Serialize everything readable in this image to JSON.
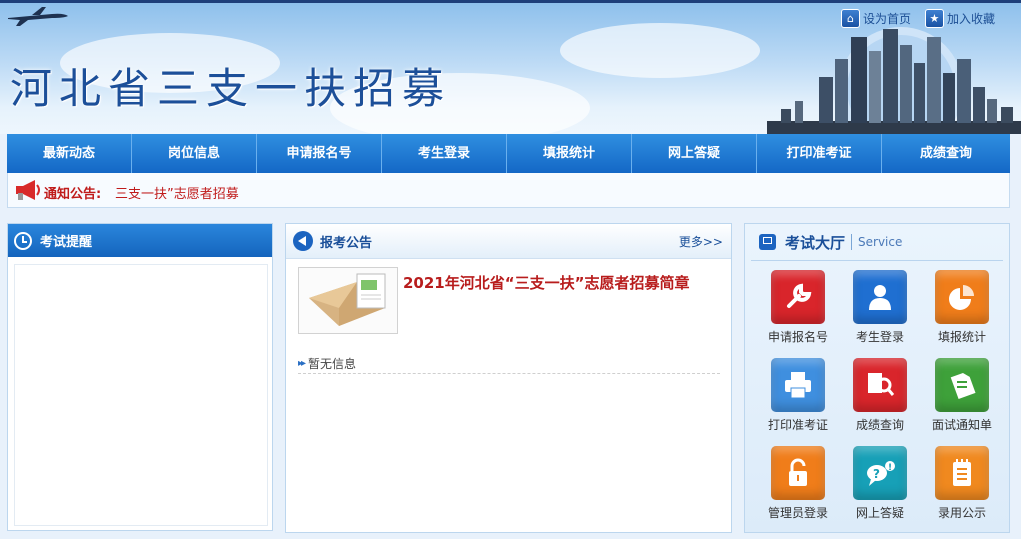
{
  "site": {
    "title": "河北省三支一扶招募"
  },
  "toplinks": [
    {
      "label": "设为首页",
      "icon": "home-icon"
    },
    {
      "label": "加入收藏",
      "icon": "star-icon"
    }
  ],
  "nav": [
    "最新动态",
    "岗位信息",
    "申请报名号",
    "考生登录",
    "填报统计",
    "网上答疑",
    "打印准考证",
    "成绩查询"
  ],
  "notice": {
    "label": "通知公告:",
    "text": "三支一扶”志愿者招募"
  },
  "left_panel": {
    "title": "考试提醒"
  },
  "mid_panel": {
    "title": "报考公告",
    "more": "更多>>",
    "headline": "2021年河北省“三支一扶”志愿者招募简章",
    "empty": "暂无信息"
  },
  "right_panel": {
    "title": "考试大厅",
    "subtitle": "Service",
    "tiles": [
      {
        "label": "申请报名号",
        "icon": "wrench-icon",
        "color": "#d9252b"
      },
      {
        "label": "考生登录",
        "icon": "user-icon",
        "color": "#1f6fd1"
      },
      {
        "label": "填报统计",
        "icon": "pie-chart-icon",
        "color": "#f07d1a"
      },
      {
        "label": "打印准考证",
        "icon": "printer-icon",
        "color": "#3f8fdf"
      },
      {
        "label": "成绩查询",
        "icon": "magnifier-icon",
        "color": "#d9252b"
      },
      {
        "label": "面试通知单",
        "icon": "document-icon",
        "color": "#3ea13a"
      },
      {
        "label": "管理员登录",
        "icon": "lock-icon",
        "color": "#f07d1a"
      },
      {
        "label": "网上答疑",
        "icon": "question-bubble-icon",
        "color": "#17a0b7"
      },
      {
        "label": "录用公示",
        "icon": "notepad-icon",
        "color": "#f0891f"
      }
    ]
  },
  "colors": {
    "nav": "#1a6fcf",
    "notice_red": "#c01b1b",
    "title_blue": "#1c4f99"
  }
}
